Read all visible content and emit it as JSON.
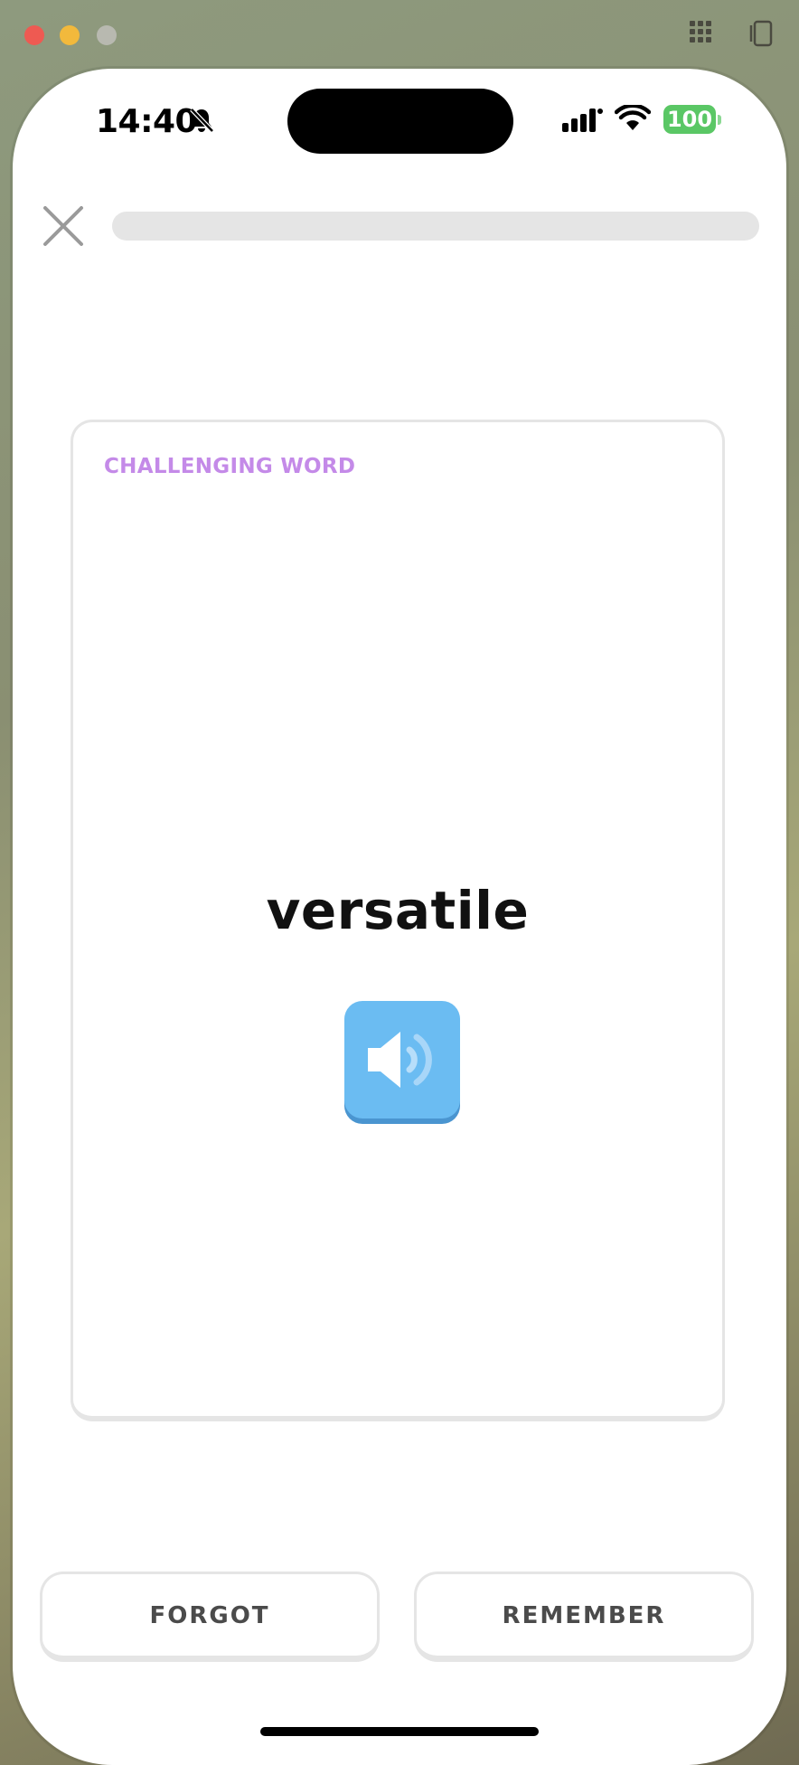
{
  "status_bar": {
    "time": "14:40",
    "battery": "100"
  },
  "progress": {
    "fraction": 0.0
  },
  "card": {
    "tag": "CHALLENGING WORD",
    "word": "versatile"
  },
  "buttons": {
    "forgot_label": "FORGOT",
    "remember_label": "REMEMBER"
  },
  "colors": {
    "tag": "#c48ae8",
    "audio_button": "#6bbcf2",
    "battery": "#5ac765"
  }
}
